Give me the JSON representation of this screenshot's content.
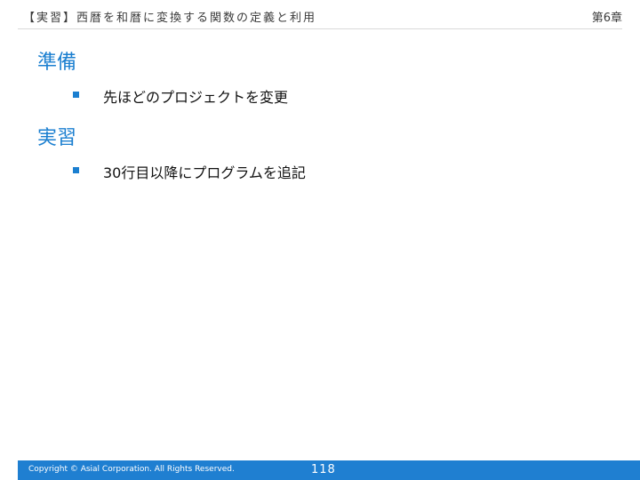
{
  "header": {
    "title": "【実習】西暦を和暦に変換する関数の定義と利用",
    "chapter": "第6章"
  },
  "sections": [
    {
      "heading": "準備",
      "bullets": [
        "先ほどのプロジェクトを変更"
      ]
    },
    {
      "heading": "実習",
      "bullets": [
        "30行目以降にプログラムを追記"
      ]
    }
  ],
  "footer": {
    "copyright": "Copyright © Asial Corporation. All Rights Reserved.",
    "page_number": "118"
  },
  "colors": {
    "accent": "#1b7fd0",
    "footer_bar": "#1f7fd1"
  }
}
